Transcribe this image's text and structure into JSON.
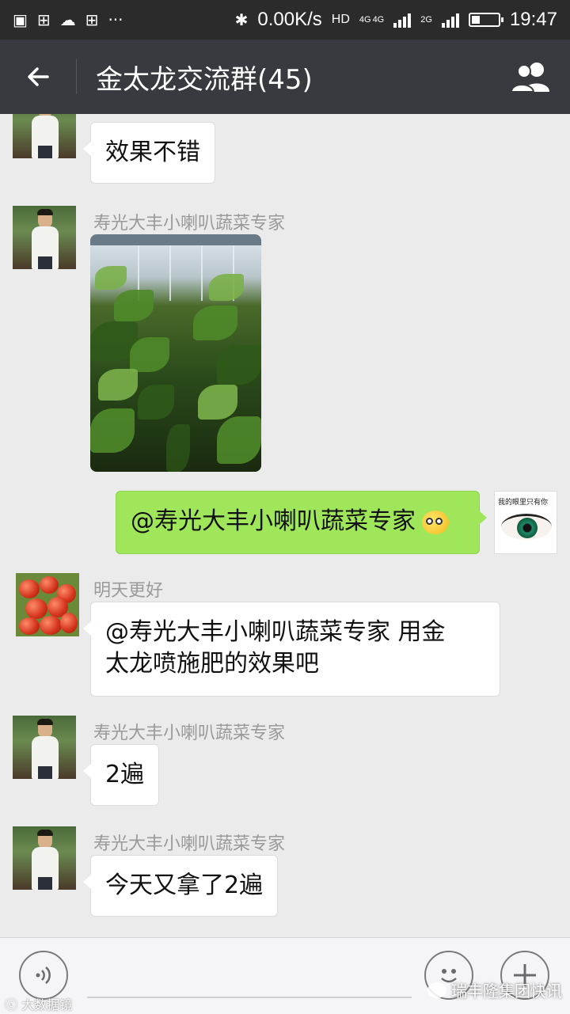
{
  "status_bar": {
    "network_speed": "0.00K/s",
    "hd_label": "HD",
    "net_4g_1": "4G",
    "net_4g_2": "4G",
    "net_2g": "2G",
    "time": "19:47",
    "battery_level": 0.3
  },
  "header": {
    "title": "金太龙交流群(45)"
  },
  "messages": [
    {
      "sender": "",
      "text": "效果不错"
    },
    {
      "sender": "寿光大丰小喇叭蔬菜专家",
      "image_description_icon": "greenhouse-photo"
    },
    {
      "sender": "",
      "text": "@寿光大丰小喇叭蔬菜专家",
      "mine": true,
      "avatar_caption": "我的眼里只有你"
    },
    {
      "sender": "明天更好",
      "text_line1": "@寿光大丰小喇叭蔬菜专家 用金",
      "text_line2": "太龙喷施肥的效果吧"
    },
    {
      "sender": "寿光大丰小喇叭蔬菜专家",
      "text": "2遍"
    },
    {
      "sender": "寿光大丰小喇叭蔬菜专家",
      "text": "今天又拿了2遍"
    }
  ],
  "input_bar": {
    "voice_icon": "voice-icon",
    "emoji_icon": "emoji-icon",
    "plus_icon": "plus-icon"
  },
  "watermarks": {
    "left": "大数据镜",
    "right": "瑞丰隆集团快讯"
  },
  "colors": {
    "status_bar": "#2b2b2b",
    "title_bar": "#393a3f",
    "chat_bg": "#ebebeb",
    "my_bubble": "#9fe65a"
  }
}
